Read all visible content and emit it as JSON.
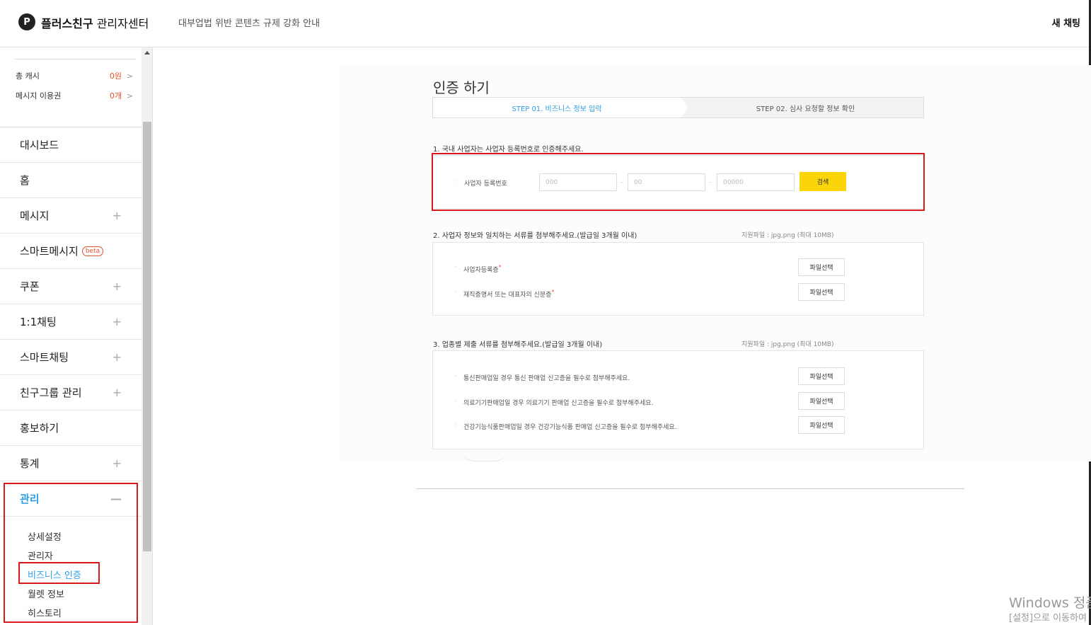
{
  "header": {
    "logo_glyph": "P",
    "brand_bold": "플러스친구",
    "brand_rest": " 관리자센터",
    "notice": "대부업법 위반 콘텐츠 규제 강화 안내",
    "new_chat": "새 채팅"
  },
  "sidebar": {
    "stats": [
      {
        "label": "총 캐시",
        "value": "0원"
      },
      {
        "label": "메시지 이용권",
        "value": "0개"
      }
    ],
    "chevron": ">",
    "menu": [
      {
        "label": "대시보드"
      },
      {
        "label": "홈"
      },
      {
        "label": "메시지",
        "plus": "+"
      },
      {
        "label": "스마트메시지",
        "badge": "beta"
      },
      {
        "label": "쿠폰",
        "plus": "+"
      },
      {
        "label": "1:1채팅",
        "plus": "+"
      },
      {
        "label": "스마트채팅",
        "plus": "+"
      },
      {
        "label": "친구그룹 관리",
        "plus": "+"
      },
      {
        "label": "홍보하기"
      },
      {
        "label": "통계",
        "plus": "+"
      },
      {
        "label": "관리",
        "minus": "—"
      }
    ],
    "submenu": [
      "상세설정",
      "관리자",
      "비즈니스 인증",
      "월렛 정보",
      "히스토리"
    ]
  },
  "main": {
    "title": "인증 하기",
    "step1": "STEP 01. 비즈니스 정보 입력",
    "step2": "STEP 02. 심사 요청할 정보 확인",
    "section1": "1. 국내 사업자는 사업자 등록번호로 인증해주세요.",
    "biz_no_label": "사업자 등록번호",
    "biz_no_placeholders": [
      "000",
      "00",
      "00000"
    ],
    "dash": "-",
    "search": "검색",
    "section2": "2. 사업자 정보와 일치하는 서류를 첨부해주세요.(발급일 3개월 이내)",
    "file_hint": "지원파일 : jpg,png (최대 10MB)",
    "docs2": [
      "사업자등록증",
      "재직증명서 또는 대표자의 신분증"
    ],
    "required_mark": "*",
    "file_select": "파일선택",
    "section3": "3. 업종별 제출 서류를 첨부해주세요.(발급일 3개월 이내)",
    "docs3": [
      "통신판매업일 경우 통신 판매업 신고증을 필수로 첨부해주세요.",
      "의료기기판매업일 경우 의료기기 판매업 신고증을 필수로 첨부해주세요.",
      "건강기능식품판매업일 경우 건강기능식품 판매업 신고증을 필수로 첨부해주세요."
    ],
    "bullet": "·"
  },
  "watermark": {
    "line1": "Windows 정품",
    "line2": "[설정]으로 이동하여"
  }
}
